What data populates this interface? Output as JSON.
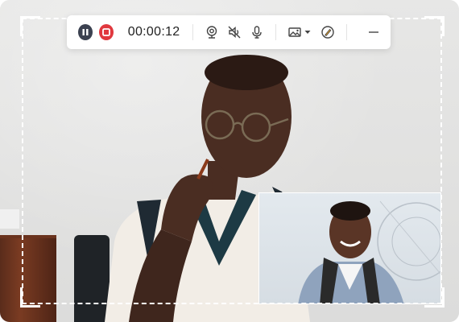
{
  "recorder": {
    "timer": "00:00:12",
    "controls": {
      "pause_icon": "pause-icon",
      "stop_icon": "stop-icon",
      "webcam_icon": "webcam-icon",
      "speaker_muted_icon": "speaker-muted-icon",
      "microphone_icon": "microphone-icon",
      "screenshot_icon": "screenshot-icon",
      "dropdown_icon": "chevron-down-icon",
      "annotate_icon": "pen-annotate-icon",
      "minimize_icon": "minimize-icon"
    }
  },
  "colors": {
    "toolbar_bg": "#ffffff",
    "pause": "#3b4150",
    "stop": "#e0383e",
    "frame": "#ffffff"
  }
}
